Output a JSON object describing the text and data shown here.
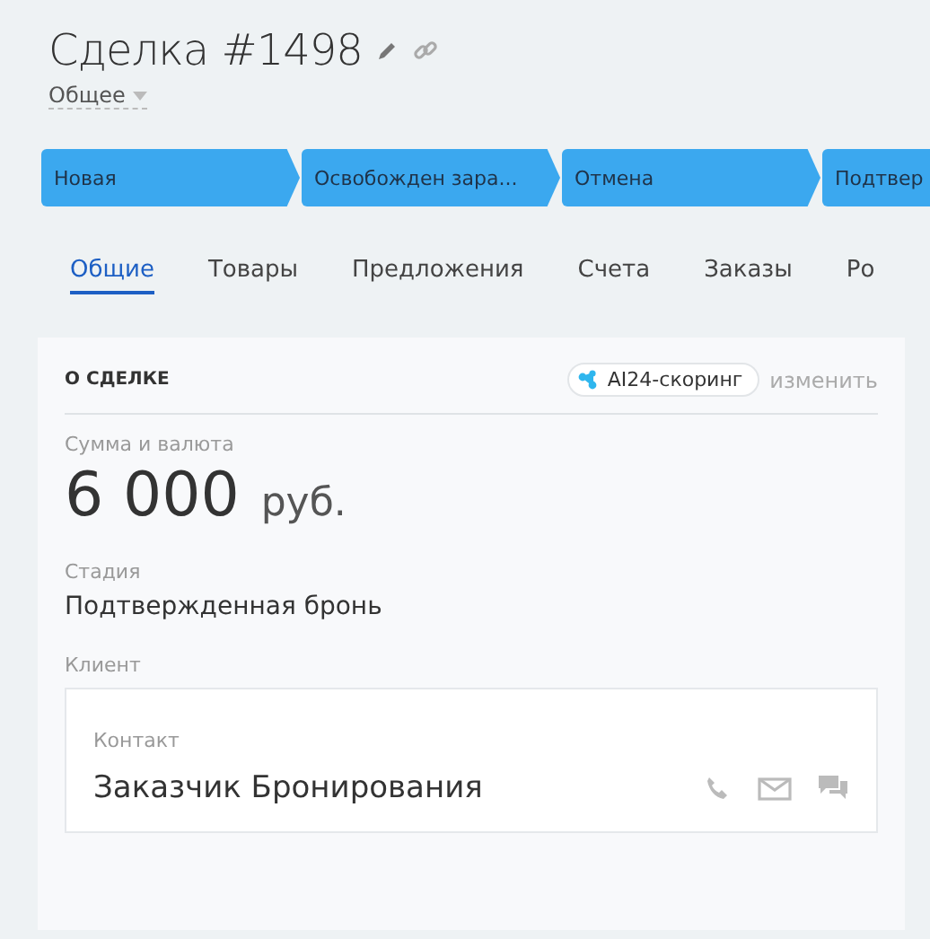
{
  "title": "Сделка #1498",
  "category": "Общее",
  "stages": [
    {
      "label": "Новая"
    },
    {
      "label": "Освобожден зара..."
    },
    {
      "label": "Отмена"
    },
    {
      "label": "Подтвер"
    }
  ],
  "tabs": [
    {
      "label": "Общие",
      "selected": true
    },
    {
      "label": "Товары",
      "selected": false
    },
    {
      "label": "Предложения",
      "selected": false
    },
    {
      "label": "Счета",
      "selected": false
    },
    {
      "label": "Заказы",
      "selected": false
    },
    {
      "label": "Ро",
      "selected": false
    }
  ],
  "section": {
    "title": "О СДЕЛКЕ",
    "scoring": "AI24-скоринг",
    "edit": "изменить",
    "amount_label": "Сумма и валюта",
    "amount": "6 000",
    "currency": "руб.",
    "stage_label": "Стадия",
    "stage": "Подтвержденная бронь",
    "client_label": "Клиент",
    "contact_label": "Контакт",
    "contact": "Заказчик Бронирования"
  }
}
